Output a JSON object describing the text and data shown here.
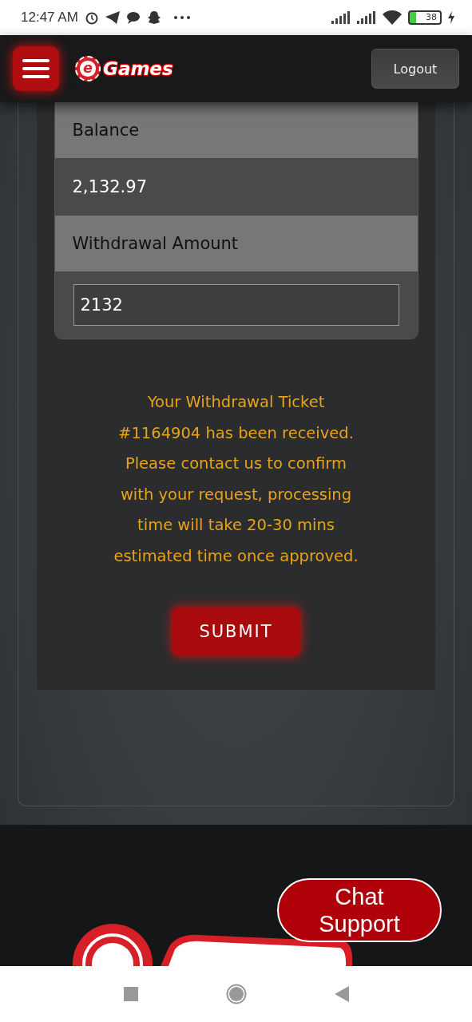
{
  "status_bar": {
    "time": "12:47 AM",
    "battery": "38"
  },
  "header": {
    "logo_mark": "e",
    "logo_text": "Games",
    "logout": "Logout"
  },
  "form": {
    "balance_label": "Balance",
    "balance_value": "2,132.97",
    "amount_label": "Withdrawal Amount",
    "amount_value": "2132"
  },
  "message": [
    "Your Withdrawal Ticket",
    "#1164904 has been received.",
    "Please contact us to confirm",
    "with your request, processing",
    "time will take 20-30 mins",
    "estimated time once approved."
  ],
  "submit": "SUBMIT",
  "chat_support": "Chat Support"
}
